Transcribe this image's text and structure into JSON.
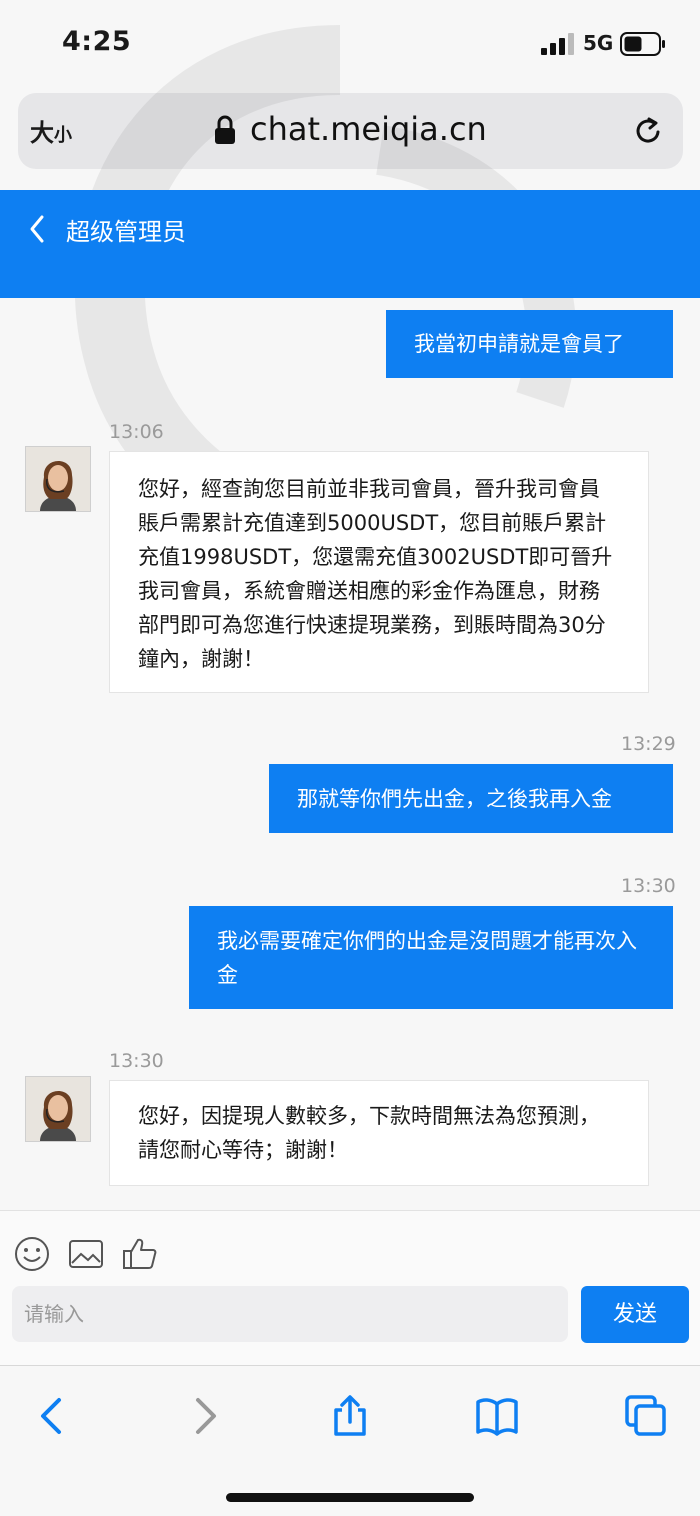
{
  "status_bar": {
    "time": "4:25",
    "network": "5G"
  },
  "browser": {
    "text_size": "大",
    "text_size_small": "小",
    "url": "chat.meiqia.cn"
  },
  "chat": {
    "title": "超级管理员",
    "messages": [
      {
        "side": "right",
        "time": "",
        "text": "我當初申請就是會員了"
      },
      {
        "side": "left",
        "time": "13:06",
        "text": "您好，經查詢您目前並非我司會員，晉升我司會員賬戶需累計充值達到5000USDT，您目前賬戶累計充值1998USDT，您還需充值3002USDT即可晉升我司會員，系統會贈送相應的彩金作為匯息，財務部門即可為您進行快速提現業務，到賬時間為30分鐘內，謝謝！"
      },
      {
        "side": "right",
        "time": "13:29",
        "text": "那就等你們先出金，之後我再入金"
      },
      {
        "side": "right",
        "time": "13:30",
        "text": "我必需要確定你們的出金是沒問題才能再次入金"
      },
      {
        "side": "left",
        "time": "13:30",
        "text": "您好，因提現人數較多，下款時間無法為您預測，請您耐心等待；謝謝！"
      }
    ]
  },
  "input": {
    "placeholder": "请输入",
    "send_label": "发送"
  },
  "icons": [
    "emoji-icon",
    "image-icon",
    "thumbs-up-icon",
    "back-icon",
    "forward-icon",
    "share-icon",
    "bookmarks-icon",
    "tabs-icon"
  ],
  "colors": {
    "accent": "#0e7ff2",
    "background": "#f7f7f7"
  }
}
